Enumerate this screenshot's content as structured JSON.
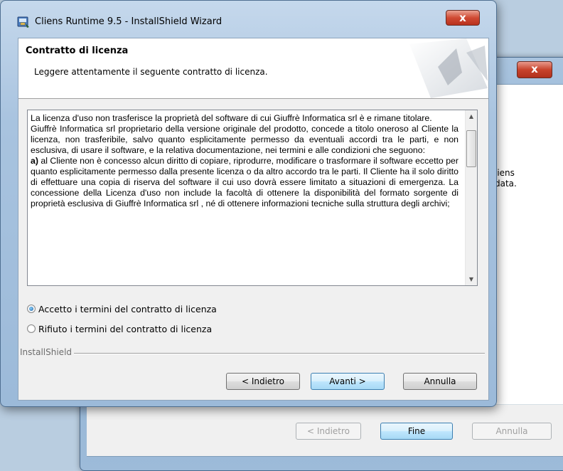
{
  "background_window": {
    "close_glyph": "x",
    "partial_text_line1": "liens",
    "partial_text_line2": "data.",
    "buttons": {
      "back": "< Indietro",
      "finish": "Fine",
      "cancel": "Annulla"
    }
  },
  "window": {
    "title": "Cliens Runtime 9.5 - InstallShield Wizard",
    "close_glyph": "x",
    "icon": "installer-icon"
  },
  "header": {
    "title": "Contratto di licenza",
    "subtitle": "Leggere attentamente il seguente contratto di licenza."
  },
  "license": {
    "paragraphs": [
      "La licenza d'uso non trasferisce la proprietà del software di cui Giuffrè Informatica srl è e rimane titolare.",
      "Giuffrè Informatica srl proprietario della versione originale del prodotto, concede a titolo oneroso al Cliente la licenza, non trasferibile, salvo quanto esplicitamente permesso da eventuali accordi tra le parti,  e non esclusiva, di usare il software, e la relativa documentazione, nei termini e alle condizioni che seguono:"
    ],
    "clause_a_label": "a)",
    "clause_a_text": " al Cliente non è concesso alcun diritto di copiare, riprodurre, modificare o trasformare il software eccetto per quanto esplicitamente permesso dalla presente licenza o da altro accordo tra le parti. Il Cliente ha il solo diritto di effettuare una copia di riserva del software il cui uso dovrà essere limitato a situazioni di emergenza. La concessione della Licenza d'uso non include la facoltà di ottenere la disponibilità del formato sorgente di proprietà esclusiva di Giuffrè Informatica srl , né di ottenere informazioni tecniche sulla struttura degli archivi;"
  },
  "options": {
    "accept": "Accetto i termini del contratto di licenza",
    "decline": "Rifiuto i termini del contratto di licenza",
    "selected": "accept"
  },
  "brand": "InstallShield",
  "buttons": {
    "back": "< Indietro",
    "next": "Avanti >",
    "cancel": "Annulla"
  }
}
